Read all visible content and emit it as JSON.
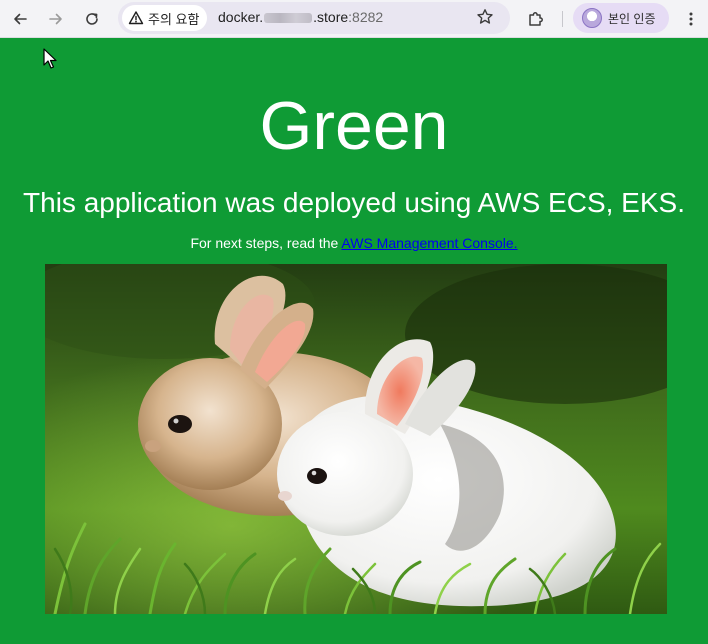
{
  "browser": {
    "security_label": "주의 요함",
    "url_host_prefix": "docker.",
    "url_host_suffix": ".store",
    "url_port": ":8282",
    "profile_label": "본인 인증",
    "icons": {
      "back": "arrow-left-icon",
      "forward": "arrow-right-icon",
      "reload": "reload-icon",
      "warning": "warning-triangle-icon",
      "bookmark": "star-icon",
      "extensions": "puzzle-icon",
      "menu": "kebab-menu-icon"
    }
  },
  "page": {
    "title": "Green",
    "subtitle": "This application was deployed using AWS ECS, EKS.",
    "next_steps_prefix": "For next steps, read the ",
    "console_link_label": "AWS Management Console.",
    "background_color": "#0f9b35",
    "link_color": "#0000ee"
  }
}
